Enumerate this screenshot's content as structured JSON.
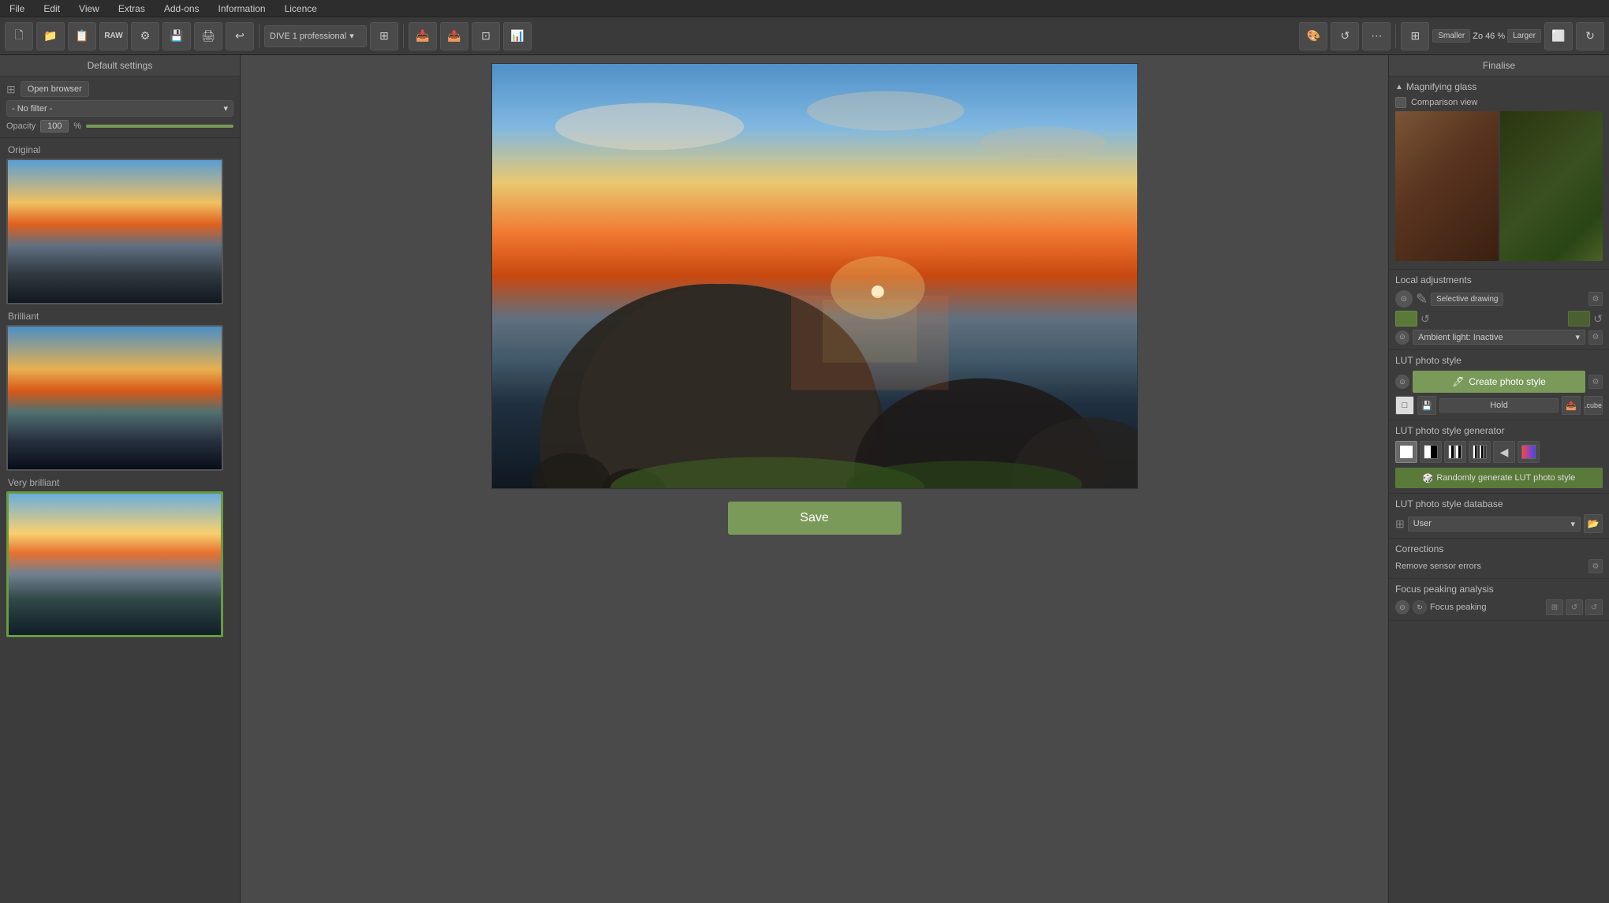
{
  "menu": {
    "items": [
      "File",
      "Edit",
      "View",
      "Extras",
      "Add-ons",
      "Information",
      "Licence"
    ]
  },
  "toolbar": {
    "profile_label": "DIVE 1 professional",
    "zoom_smaller": "Smaller",
    "zoom_value": "46",
    "zoom_percent": "%",
    "zoom_larger": "Larger"
  },
  "left_sidebar": {
    "header": "Default settings",
    "open_browser": "Open browser",
    "filter_label": "- No filter -",
    "opacity_label": "Opacity",
    "opacity_value": "100",
    "opacity_pct": "%",
    "previews": [
      {
        "label": "Original",
        "selected": false
      },
      {
        "label": "Brilliant",
        "selected": false
      },
      {
        "label": "Very brilliant",
        "selected": true
      }
    ]
  },
  "right_sidebar": {
    "header": "Finalise",
    "magnifying_glass": {
      "title": "Magnifying glass",
      "comparison_view": "Comparison view"
    },
    "local_adjustments": {
      "title": "Local adjustments",
      "selective_drawing": "Selective drawing"
    },
    "ambient": {
      "label": "Ambient light: Inactive"
    },
    "lut_photo_style": {
      "title": "LUT photo style",
      "create_button": "Create photo style",
      "hold": "Hold",
      "cube": ".cube"
    },
    "lut_generator": {
      "title": "LUT photo style generator",
      "random_btn": "Randomly generate LUT photo style"
    },
    "lut_database": {
      "title": "LUT photo style database",
      "user_label": "User"
    },
    "corrections": {
      "title": "Corrections",
      "remove_sensor": "Remove sensor errors"
    },
    "focus_peaking": {
      "title": "Focus peaking analysis",
      "focus_label": "Focus peaking"
    }
  },
  "center": {
    "save_button": "Save"
  }
}
